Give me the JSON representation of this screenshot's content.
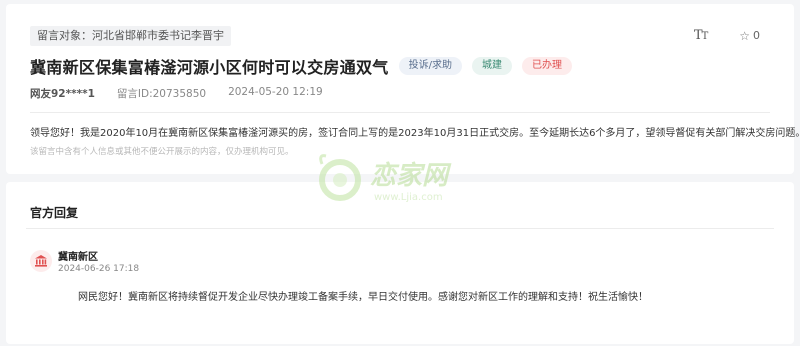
{
  "message": {
    "target_label": "留言对象：河北省邯郸市委书记李晋宇",
    "title": "冀南新区保集富椿滏河源小区何时可以交房通双气",
    "badges": [
      "投诉/求助",
      "城建",
      "已办理"
    ],
    "user": "网友92****1",
    "message_id": "留言ID:20735850",
    "datetime": "2024-05-20 12:19",
    "content": "领导您好！我是2020年10月在冀南新区保集富椿滏河源买的房，签订合同上写的是2023年10月31日正式交房。至今延期长达6个多月了，望领导督促有关部门解决交房问题。",
    "privacy_notice": "该留言中含有个人信息或其他不便公开展示的内容，仅办理机构可见。",
    "like_count": "0",
    "font_size_icon": "text-size-icon",
    "star_icon": "star-icon"
  },
  "reply": {
    "section_title": "官方回复",
    "department": "冀南新区",
    "datetime": "2024-06-26 17:18",
    "content": "网民您好！冀南新区将持续督促开发企业尽快办理竣工备案手续，早日交付使用。感谢您对新区工作的理解和支持！祝生活愉快！",
    "avatar_icon": "government-building-icon"
  },
  "watermark": {
    "brand": "恋家网",
    "url": "www.Ljia.com"
  },
  "colors": {
    "accent_red": "#e05050",
    "badge_green": "#3a8a73",
    "badge_blue": "#5a6f8e"
  }
}
